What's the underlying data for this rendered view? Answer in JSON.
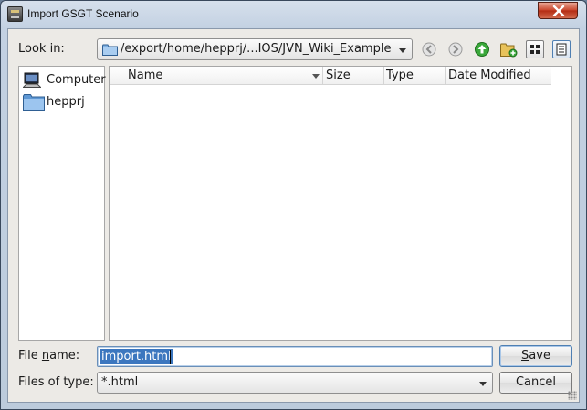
{
  "window": {
    "title": "Import GSGT Scenario"
  },
  "look_in": {
    "label": "Look in:",
    "path": "/export/home/hepprj/...IOS/JVN_Wiki_Example"
  },
  "toolbar": {
    "icons": [
      "back-icon",
      "forward-icon",
      "up-folder-icon",
      "new-folder-icon",
      "list-view-icon",
      "details-view-icon"
    ]
  },
  "sidebar": {
    "items": [
      {
        "label": "Computer",
        "icon": "computer-icon"
      },
      {
        "label": "hepprj",
        "icon": "folder-icon"
      }
    ]
  },
  "file_table": {
    "columns": [
      "Name",
      "Size",
      "Type",
      "Date Modified"
    ],
    "rows": []
  },
  "file_name": {
    "label_pre": "File ",
    "label_mnemonic": "n",
    "label_post": "ame:",
    "value": "import.html"
  },
  "file_type": {
    "label": "Files of type:",
    "value": "*.html"
  },
  "buttons": {
    "save_label": "Save",
    "save_mnemonic": "S",
    "save_rest": "ave",
    "cancel_label": "Cancel"
  },
  "colors": {
    "selection": "#3c77bf",
    "close_button": "#c8432a",
    "folder": "#6aa0d8",
    "up_arrow": "#2e9a2e"
  }
}
